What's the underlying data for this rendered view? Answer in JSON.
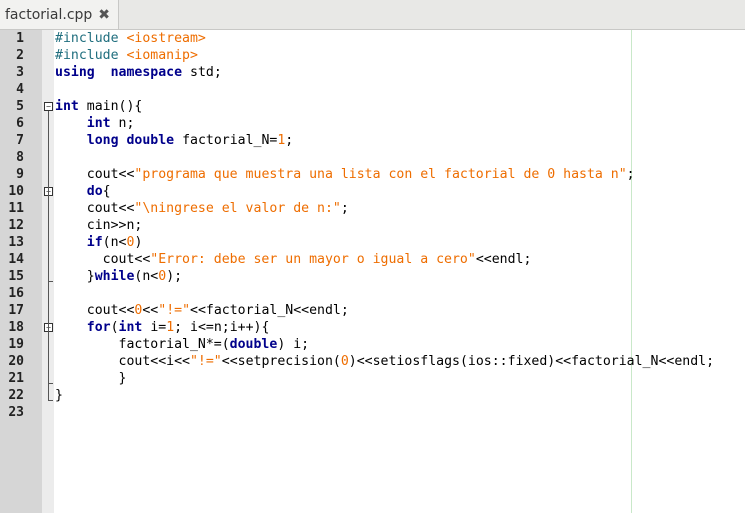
{
  "tab": {
    "title": "factorial.cpp",
    "close_symbol": "✖"
  },
  "colors": {
    "keyword": "#00008b",
    "string": "#ee6d00",
    "preprocessor": "#1f6e7e",
    "gutter": "#d6d6d6"
  },
  "lines": [
    {
      "n": "1",
      "segs": [
        [
          "pp",
          "#include "
        ],
        [
          "inc",
          "<iostream>"
        ]
      ]
    },
    {
      "n": "2",
      "segs": [
        [
          "pp",
          "#include "
        ],
        [
          "inc",
          "<iomanip>"
        ]
      ]
    },
    {
      "n": "3",
      "segs": [
        [
          "kw",
          "using"
        ],
        [
          "",
          "  "
        ],
        [
          "kw",
          "namespace"
        ],
        [
          "",
          ""
        ],
        [
          "",
          " std;"
        ]
      ]
    },
    {
      "n": "4",
      "segs": []
    },
    {
      "n": "5",
      "segs": [
        [
          "kw",
          "int"
        ],
        [
          "",
          " main(){"
        ]
      ]
    },
    {
      "n": "6",
      "segs": [
        [
          "",
          "    "
        ],
        [
          "kw",
          "int"
        ],
        [
          "",
          " n;"
        ]
      ]
    },
    {
      "n": "7",
      "segs": [
        [
          "",
          "    "
        ],
        [
          "kw",
          "long"
        ],
        [
          "",
          " "
        ],
        [
          "kw",
          "double"
        ],
        [
          "",
          " factorial_N="
        ],
        [
          "num",
          "1"
        ],
        [
          "",
          ";"
        ]
      ]
    },
    {
      "n": "8",
      "segs": []
    },
    {
      "n": "9",
      "segs": [
        [
          "",
          "    cout<<"
        ],
        [
          "str",
          "\"programa que muestra una lista con el factorial de 0 hasta n\""
        ],
        [
          "",
          ";"
        ]
      ]
    },
    {
      "n": "10",
      "segs": [
        [
          "",
          "    "
        ],
        [
          "kw",
          "do"
        ],
        [
          "",
          "{"
        ]
      ]
    },
    {
      "n": "11",
      "segs": [
        [
          "",
          "    cout<<"
        ],
        [
          "str",
          "\"\\ningrese el valor de n:\""
        ],
        [
          "",
          ";"
        ]
      ]
    },
    {
      "n": "12",
      "segs": [
        [
          "",
          "    cin>>n;"
        ]
      ]
    },
    {
      "n": "13",
      "segs": [
        [
          "",
          "    "
        ],
        [
          "kw",
          "if"
        ],
        [
          "",
          "(n<"
        ],
        [
          "num",
          "0"
        ],
        [
          "",
          ")"
        ]
      ]
    },
    {
      "n": "14",
      "segs": [
        [
          "",
          "      cout<<"
        ],
        [
          "str",
          "\"Error: debe ser un mayor o igual a cero\""
        ],
        [
          "",
          "<<endl;"
        ]
      ]
    },
    {
      "n": "15",
      "segs": [
        [
          "",
          "    }"
        ],
        [
          "kw",
          "while"
        ],
        [
          "",
          "(n<"
        ],
        [
          "num",
          "0"
        ],
        [
          "",
          ");"
        ]
      ]
    },
    {
      "n": "16",
      "segs": []
    },
    {
      "n": "17",
      "segs": [
        [
          "",
          "    cout<<"
        ],
        [
          "num",
          "0"
        ],
        [
          "",
          "<<"
        ],
        [
          "str",
          "\"!=\""
        ],
        [
          "",
          "<<factorial_N<<endl;"
        ]
      ]
    },
    {
      "n": "18",
      "segs": [
        [
          "",
          "    "
        ],
        [
          "kw",
          "for"
        ],
        [
          "",
          "("
        ],
        [
          "kw",
          "int"
        ],
        [
          "",
          " i="
        ],
        [
          "num",
          "1"
        ],
        [
          "",
          "; i<=n;i++){"
        ]
      ]
    },
    {
      "n": "19",
      "segs": [
        [
          "",
          "        factorial_N*=("
        ],
        [
          "kw",
          "double"
        ],
        [
          "",
          ") i;"
        ]
      ]
    },
    {
      "n": "20",
      "segs": [
        [
          "",
          "        cout<<i<<"
        ],
        [
          "str",
          "\"!=\""
        ],
        [
          "",
          "<<setprecision("
        ],
        [
          "num",
          "0"
        ],
        [
          "",
          ")<<setiosflags(ios::fixed)<<factorial_N<<endl;"
        ]
      ]
    },
    {
      "n": "21",
      "segs": [
        [
          "",
          "        }"
        ]
      ]
    },
    {
      "n": "22",
      "segs": [
        [
          "",
          "}"
        ]
      ]
    },
    {
      "n": "23",
      "segs": []
    }
  ],
  "folds": [
    5,
    10,
    18
  ]
}
